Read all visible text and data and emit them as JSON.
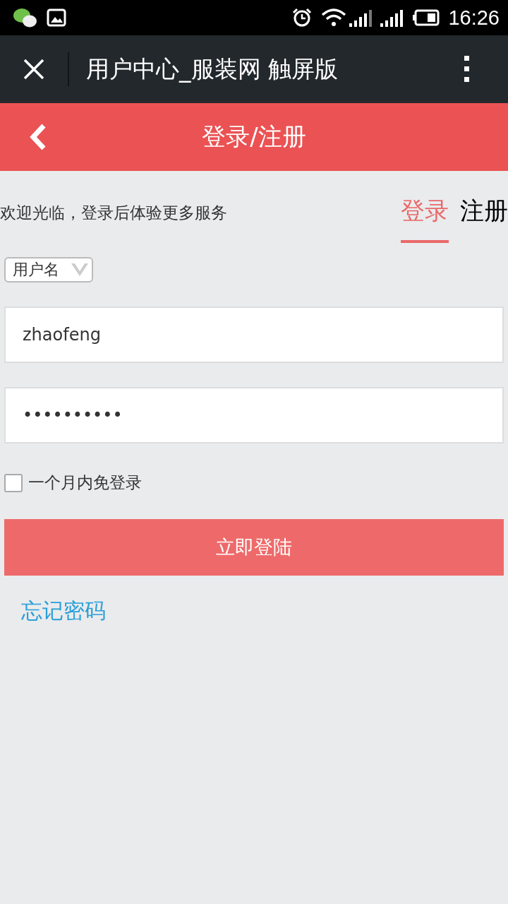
{
  "status_bar": {
    "time": "16:26"
  },
  "browser_bar": {
    "title": "用户中心_服装网 触屏版"
  },
  "header": {
    "title": "登录/注册"
  },
  "welcome": "欢迎光临，登录后体验更多服务",
  "tabs": [
    {
      "label": "登录",
      "selected": true
    },
    {
      "label": "注册",
      "selected": false
    }
  ],
  "login_type": {
    "value": "用户名"
  },
  "username": {
    "value": "zhaofeng"
  },
  "password": {
    "value": "••••••••••"
  },
  "remember": {
    "label": "一个月内免登录",
    "checked": false
  },
  "submit": "立即登陆",
  "forgot_link": "忘记密码"
}
